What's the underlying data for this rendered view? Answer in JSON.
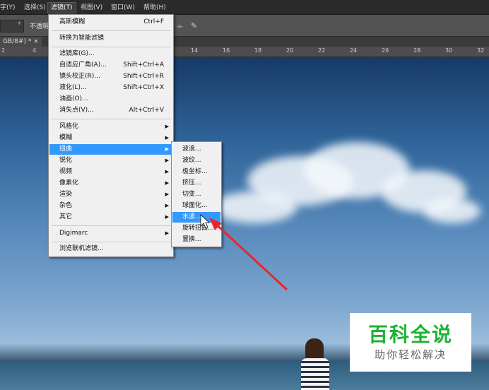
{
  "menubar": {
    "items": [
      {
        "label": "字(Y)"
      },
      {
        "label": "选择(S)"
      },
      {
        "label": "滤镜(T)"
      },
      {
        "label": "视图(V)"
      },
      {
        "label": "窗口(W)"
      },
      {
        "label": "帮助(H)"
      }
    ]
  },
  "options": {
    "opacity_label": "不透明",
    "spinner_symbol": "÷"
  },
  "document_tab": {
    "label": "GB/8#) * ×"
  },
  "ruler": {
    "ticks": [
      "2",
      "4",
      "14",
      "16",
      "18",
      "20",
      "22",
      "24",
      "26",
      "28",
      "30",
      "32"
    ]
  },
  "filter_menu": {
    "items": [
      {
        "label": "高斯模糊",
        "shortcut": "Ctrl+F"
      },
      {
        "label": "转换为智能滤镜"
      },
      {
        "label": "滤镜库(G)..."
      },
      {
        "label": "自适应广角(A)...",
        "shortcut": "Shift+Ctrl+A"
      },
      {
        "label": "镜头校正(R)...",
        "shortcut": "Shift+Ctrl+R"
      },
      {
        "label": "液化(L)...",
        "shortcut": "Shift+Ctrl+X"
      },
      {
        "label": "油画(O)..."
      },
      {
        "label": "消失点(V)...",
        "shortcut": "Alt+Ctrl+V"
      },
      {
        "label": "风格化"
      },
      {
        "label": "模糊"
      },
      {
        "label": "扭曲"
      },
      {
        "label": "锐化"
      },
      {
        "label": "视频"
      },
      {
        "label": "像素化"
      },
      {
        "label": "渲染"
      },
      {
        "label": "杂色"
      },
      {
        "label": "其它"
      },
      {
        "label": "Digimarc"
      },
      {
        "label": "浏览联机滤镜..."
      }
    ]
  },
  "distort_submenu": {
    "items": [
      {
        "label": "波浪..."
      },
      {
        "label": "波纹..."
      },
      {
        "label": "极坐标..."
      },
      {
        "label": "挤压..."
      },
      {
        "label": "切变..."
      },
      {
        "label": "球面化..."
      },
      {
        "label": "水波..."
      },
      {
        "label": "旋转扭曲..."
      },
      {
        "label": "置换..."
      }
    ]
  },
  "watermark": {
    "title": "百科全说",
    "subtitle": "助你轻松解决"
  },
  "colors": {
    "highlight": "#3399ff",
    "annotation_arrow": "#e8262b",
    "watermark_green": "#1db335"
  },
  "icons": {
    "submenu_arrow": "triangle-right-icon",
    "cursor": "mouse-pointer-icon"
  }
}
